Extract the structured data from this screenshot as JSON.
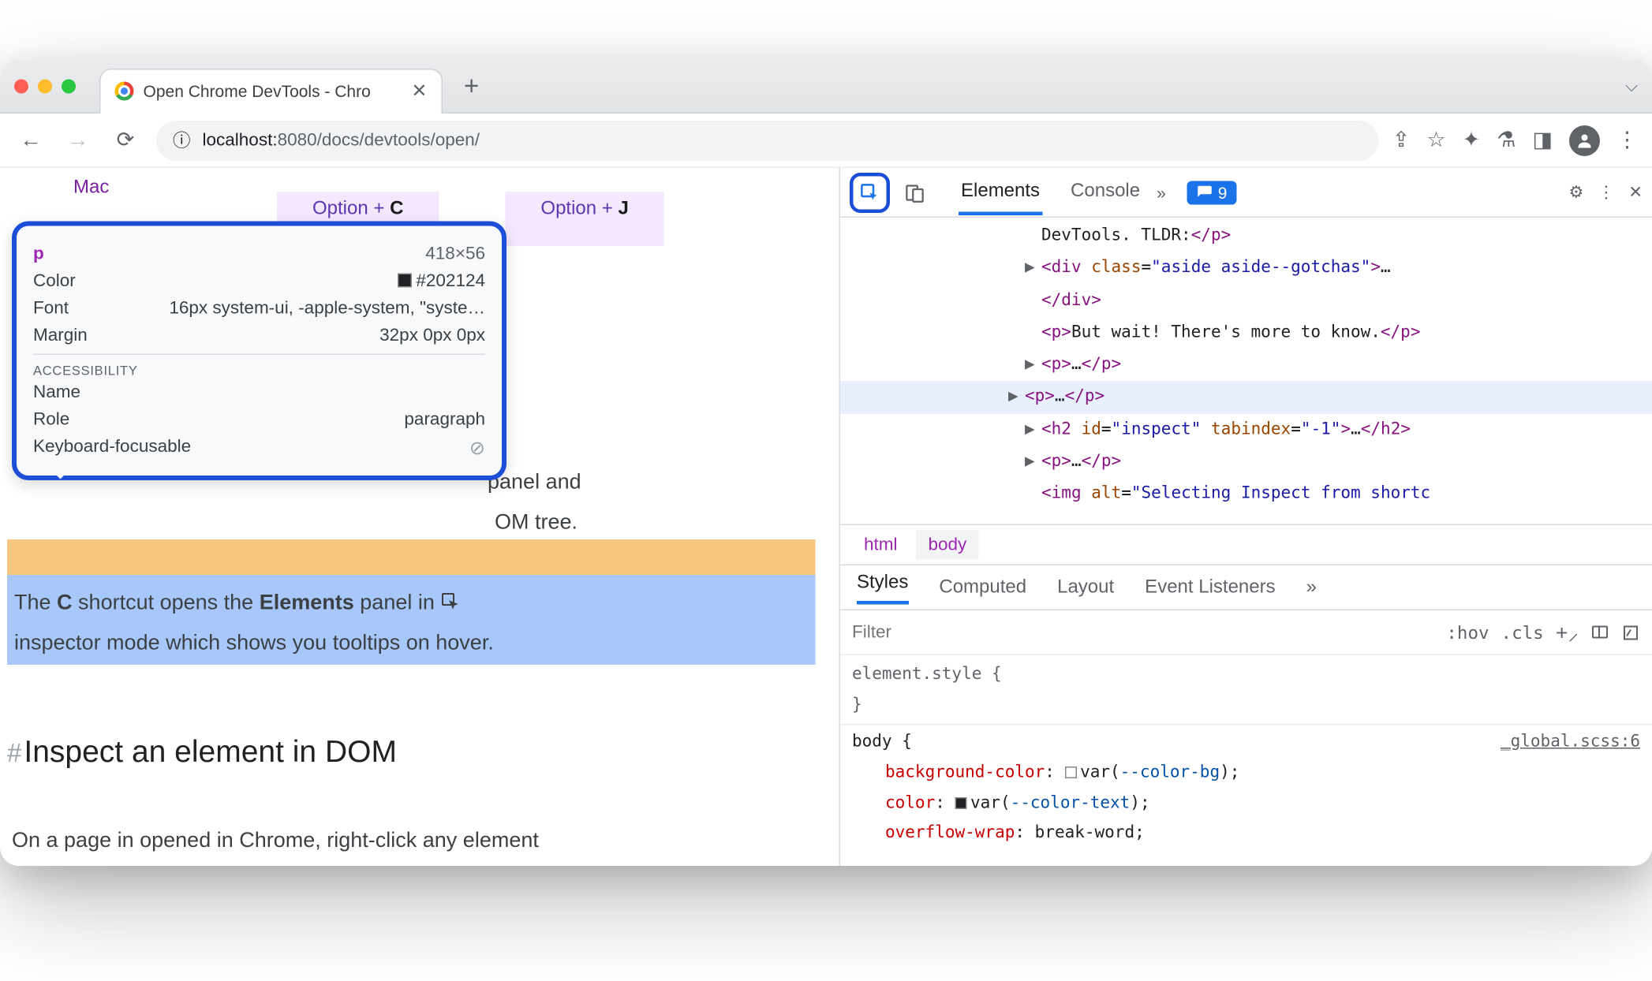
{
  "window": {
    "tab_title": "Open Chrome DevTools - Chro",
    "url_host": "localhost:",
    "url_port": "8080",
    "url_path": "/docs/devtools/open/"
  },
  "page": {
    "os_tab": "Mac",
    "shortcut_c": "Option + ",
    "shortcut_c_key": "C",
    "shortcut_j": "Option + ",
    "shortcut_j_key": "J",
    "masked_line1": "panel and",
    "masked_line2": "OM tree.",
    "highlight_text_1a": "The ",
    "highlight_text_1b": "C",
    "highlight_text_1c": " shortcut opens the ",
    "highlight_text_1d": "Elements",
    "highlight_text_1e": " panel in ",
    "highlight_text_2": "inspector mode which shows you tooltips on hover.",
    "heading": "Inspect an element in DOM",
    "body": "On a page in opened in Chrome, right-click any element"
  },
  "tooltip": {
    "tag": "p",
    "dimensions": "418×56",
    "color_label": "Color",
    "color_value": "#202124",
    "font_label": "Font",
    "font_value": "16px system-ui, -apple-system, \"syste…",
    "margin_label": "Margin",
    "margin_value": "32px 0px 0px",
    "a11y_heading": "ACCESSIBILITY",
    "name_label": "Name",
    "role_label": "Role",
    "role_value": "paragraph",
    "kbf_label": "Keyboard-focusable"
  },
  "devtools": {
    "tabs": {
      "elements": "Elements",
      "console": "Console"
    },
    "issues_count": "9",
    "dom": {
      "l1": "DevTools. TLDR:",
      "l2a": "div",
      "l2b": "class",
      "l2c": "aside aside--gotchas",
      "l3": "But wait! There's more to know.",
      "l4a": "h2",
      "l4b": "id",
      "l4c": "inspect",
      "l4d": "tabindex",
      "l4e": "-1",
      "l5a": "img",
      "l5b": "alt",
      "l5c": "Selecting Inspect from shortc"
    },
    "crumbs": {
      "html": "html",
      "body": "body"
    },
    "styles_tabs": {
      "styles": "Styles",
      "computed": "Computed",
      "layout": "Layout",
      "ev": "Event Listeners"
    },
    "filter_placeholder": "Filter",
    "hov": ":hov",
    "cls": ".cls",
    "elstyle": "element.style {",
    "brace_close": "}",
    "body_sel": "body {",
    "src": "_global.scss:6",
    "bg_prop": "background-color",
    "bg_val": "var(",
    "bg_var": "--color-bg",
    "bg_end": ");",
    "color_prop": "color",
    "color_val": "var(",
    "color_var": "--color-text",
    "color_end": ");",
    "ow_prop": "overflow-wrap",
    "ow_val": "break-word;"
  }
}
